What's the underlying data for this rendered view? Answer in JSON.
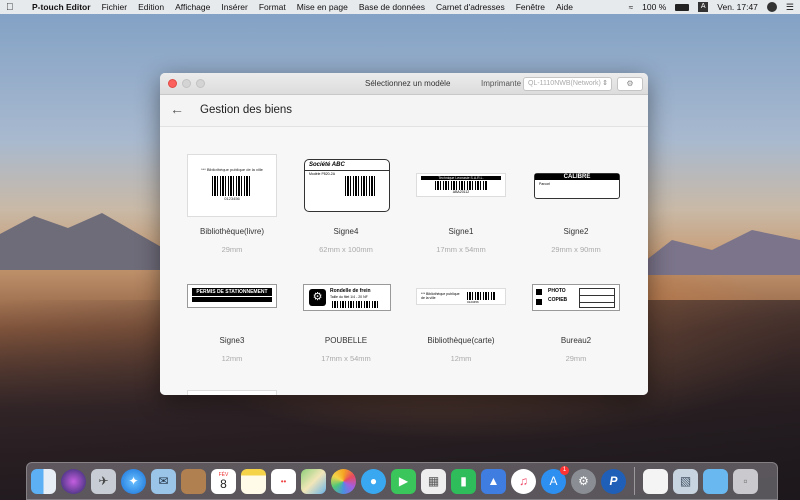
{
  "menubar": {
    "app_name": "P-touch Editor",
    "items": [
      "Fichier",
      "Edition",
      "Affichage",
      "Insérer",
      "Format",
      "Mise en page",
      "Base de données",
      "Carnet d'adresses",
      "Fenêtre",
      "Aide"
    ],
    "battery": "100 %",
    "input_source": "A",
    "clock": "Ven. 17:47"
  },
  "window": {
    "title": "Sélectionnez un modèle",
    "printer_label": "Imprimante",
    "printer_value": "QL-1110NWB(Network)",
    "page_title": "Gestion des biens"
  },
  "templates": [
    {
      "name": "Bibliothèque(livre)",
      "size": "29mm",
      "label_text": "*** Bibliothèque publique de la ville",
      "code": "0123456"
    },
    {
      "name": "Signe4",
      "size": "62mm x 100mm",
      "label_text": "Société ABC",
      "sub": "Modèle P820-2A"
    },
    {
      "name": "Signe1",
      "size": "17mm x 54mm",
      "label_text": "Technique Leonasie S.A.R.L.",
      "code": "ABA20112"
    },
    {
      "name": "Signe2",
      "size": "29mm x 90mm",
      "label_text": "CALIBRÉ",
      "sub": "Parcorl"
    },
    {
      "name": "Signe3",
      "size": "12mm",
      "label_text": "PERMIS DE STATIONNEMENT"
    },
    {
      "name": "POUBELLE",
      "size": "17mm x 54mm",
      "label_text": "Rondelle de frein",
      "sub": "Taille du filet 1/4 - 20 NF"
    },
    {
      "name": "Bibliothèque(carte)",
      "size": "12mm",
      "label_text": "*** Bibliothèque publique de la ville",
      "code": "0123456"
    },
    {
      "name": "Bureau2",
      "size": "29mm",
      "label_text": "PHOTO",
      "sub": "COPIEB"
    }
  ],
  "dock": [
    "finder",
    "siri",
    "launchpad",
    "safari",
    "mail",
    "contacts",
    "calendar",
    "notes",
    "reminders",
    "maps",
    "photos",
    "messages",
    "facetime",
    "ical",
    "numbers",
    "keynote",
    "music",
    "app-store",
    "system-preferences",
    "p-touch",
    "document",
    "preview",
    "folder",
    "trash"
  ],
  "dock_badge": "1",
  "calendar_day": "8",
  "calendar_month": "FÉV"
}
